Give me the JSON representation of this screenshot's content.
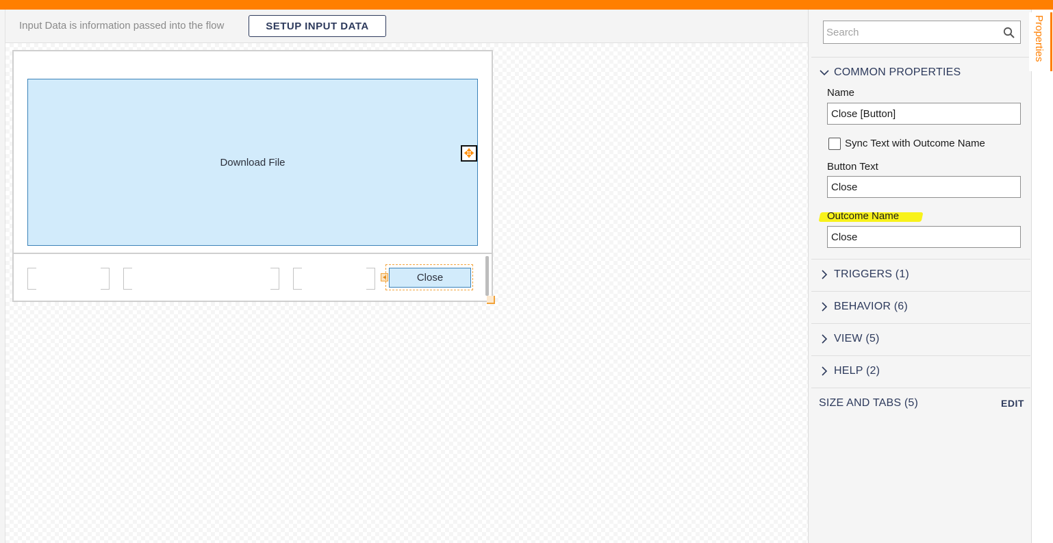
{
  "colors": {
    "accent": "#ff7f00",
    "selection_fill": "#d2ebfb",
    "selection_border": "#3b82b8",
    "highlight": "#f8f21a",
    "navy": "#2d3a5c"
  },
  "input_bar": {
    "message": "Input Data is information passed into the flow",
    "setup_button": "SETUP INPUT DATA"
  },
  "canvas": {
    "panel_label": "Download File",
    "move_icon": "move-arrows-icon",
    "close_button": "Close"
  },
  "properties": {
    "search_placeholder": "Search",
    "search_icon": "magnifier-icon",
    "common_title": "COMMON PROPERTIES",
    "name_label": "Name",
    "name_value": "Close [Button]",
    "sync_label": "Sync Text with Outcome Name",
    "sync_checked": false,
    "button_text_label": "Button Text",
    "button_text_value": "Close",
    "outcome_label": "Outcome Name",
    "outcome_value": "Close",
    "sections": [
      {
        "label": "TRIGGERS (1)"
      },
      {
        "label": "BEHAVIOR (6)"
      },
      {
        "label": "VIEW (5)"
      },
      {
        "label": "HELP (2)"
      }
    ],
    "size_tabs_label": "SIZE AND TABS (5)",
    "edit_label": "EDIT"
  },
  "side_tab": {
    "label": "Properties"
  }
}
